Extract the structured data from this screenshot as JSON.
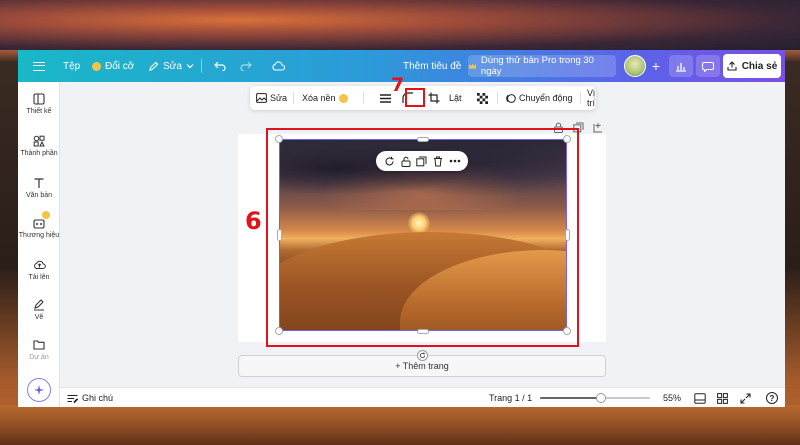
{
  "topbar": {
    "file_label": "Tệp",
    "resize_label": "Đổi cỡ",
    "edit_label": "Sửa",
    "title_label": "Thêm tiêu đề",
    "pro_label": "Dùng thử bản Pro trong 30 ngày",
    "share_label": "Chia sẻ"
  },
  "sidebar": {
    "items": [
      {
        "label": "Thiết kế",
        "icon": "layout-icon"
      },
      {
        "label": "Thành phần",
        "icon": "elements-icon"
      },
      {
        "label": "Văn bản",
        "icon": "text-icon"
      },
      {
        "label": "Thương hiệu",
        "icon": "brand-icon"
      },
      {
        "label": "Tải lên",
        "icon": "upload-cloud-icon"
      },
      {
        "label": "Vẽ",
        "icon": "draw-pen-icon"
      },
      {
        "label": "Dự án",
        "icon": "folder-icon"
      }
    ]
  },
  "context_toolbar": {
    "edit_label": "Sửa",
    "remove_bg_label": "Xóa nền",
    "flip_label": "Lật",
    "animate_label": "Chuyển động",
    "position_label": "Vị trí"
  },
  "annotations": {
    "step_crop": "7",
    "step_image": "6",
    "color": "#e0121a"
  },
  "canvas": {
    "add_page_label": "+ Thêm trang",
    "selection_color": "#7b5cf2"
  },
  "bottombar": {
    "notes_label": "Ghi chú",
    "page_label": "Trang 1 / 1",
    "zoom_label": "55%",
    "zoom_value": 55,
    "help_label": "?"
  },
  "colors": {
    "topbar_start": "#19b8c7",
    "topbar_end": "#7a4fe6",
    "accent": "#7b5cf2"
  }
}
